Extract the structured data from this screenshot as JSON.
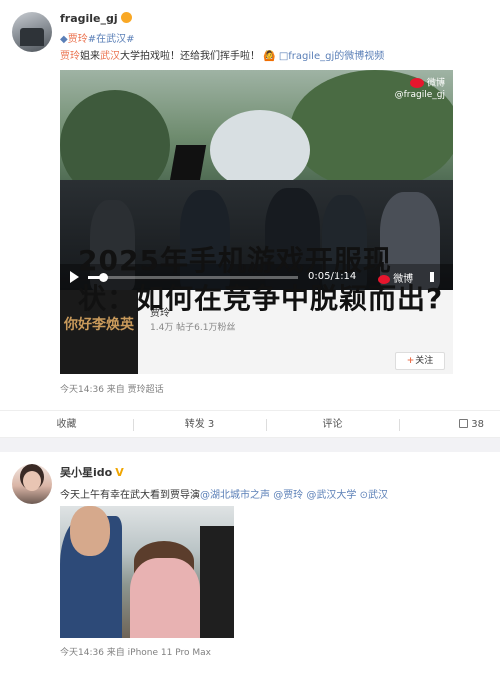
{
  "post1": {
    "username": "fragile_gj",
    "tagline": {
      "mention": "贾玲",
      "topic": "#在武汉#"
    },
    "text": {
      "mention1": "贾玲",
      "part1": "姐来",
      "mention2": "武汉",
      "part2": "大学拍戏啦！还给我们挥手啦！",
      "link": "□fragile_gj的微博视频"
    },
    "video": {
      "watermark_brand": "微博",
      "watermark_user": "@fragile_gj",
      "time": "0:05/1:14",
      "progress_fraction": 0.07,
      "logo_text": "微博"
    },
    "card": {
      "art_text": "你好李焕英",
      "name": "贾玲",
      "stats": "1.4万 帖子6.1万粉丝",
      "follow_label": "关注"
    },
    "meta": "今天14:36  来自 贾玲超话",
    "overlay_headline": "2025年手机游戏开服现状：如何在竞争中脱颖而出?"
  },
  "actions": {
    "favorite": "收藏",
    "repost": "转发 3",
    "comment": "评论",
    "like_count": "38"
  },
  "post2": {
    "username": "吴小星ido",
    "text": {
      "part1": "今天上午有幸在武大看到贾导演",
      "mention1": "@湖北城市之声",
      "mention2": "@贾玲",
      "mention3": "@武汉大学",
      "location": "武汉"
    },
    "meta": "今天14:36  来自 iPhone 11 Pro Max"
  },
  "colors": {
    "accent": "#eb7350",
    "link": "#5a7fb7",
    "weibo_red": "#e6162d"
  }
}
